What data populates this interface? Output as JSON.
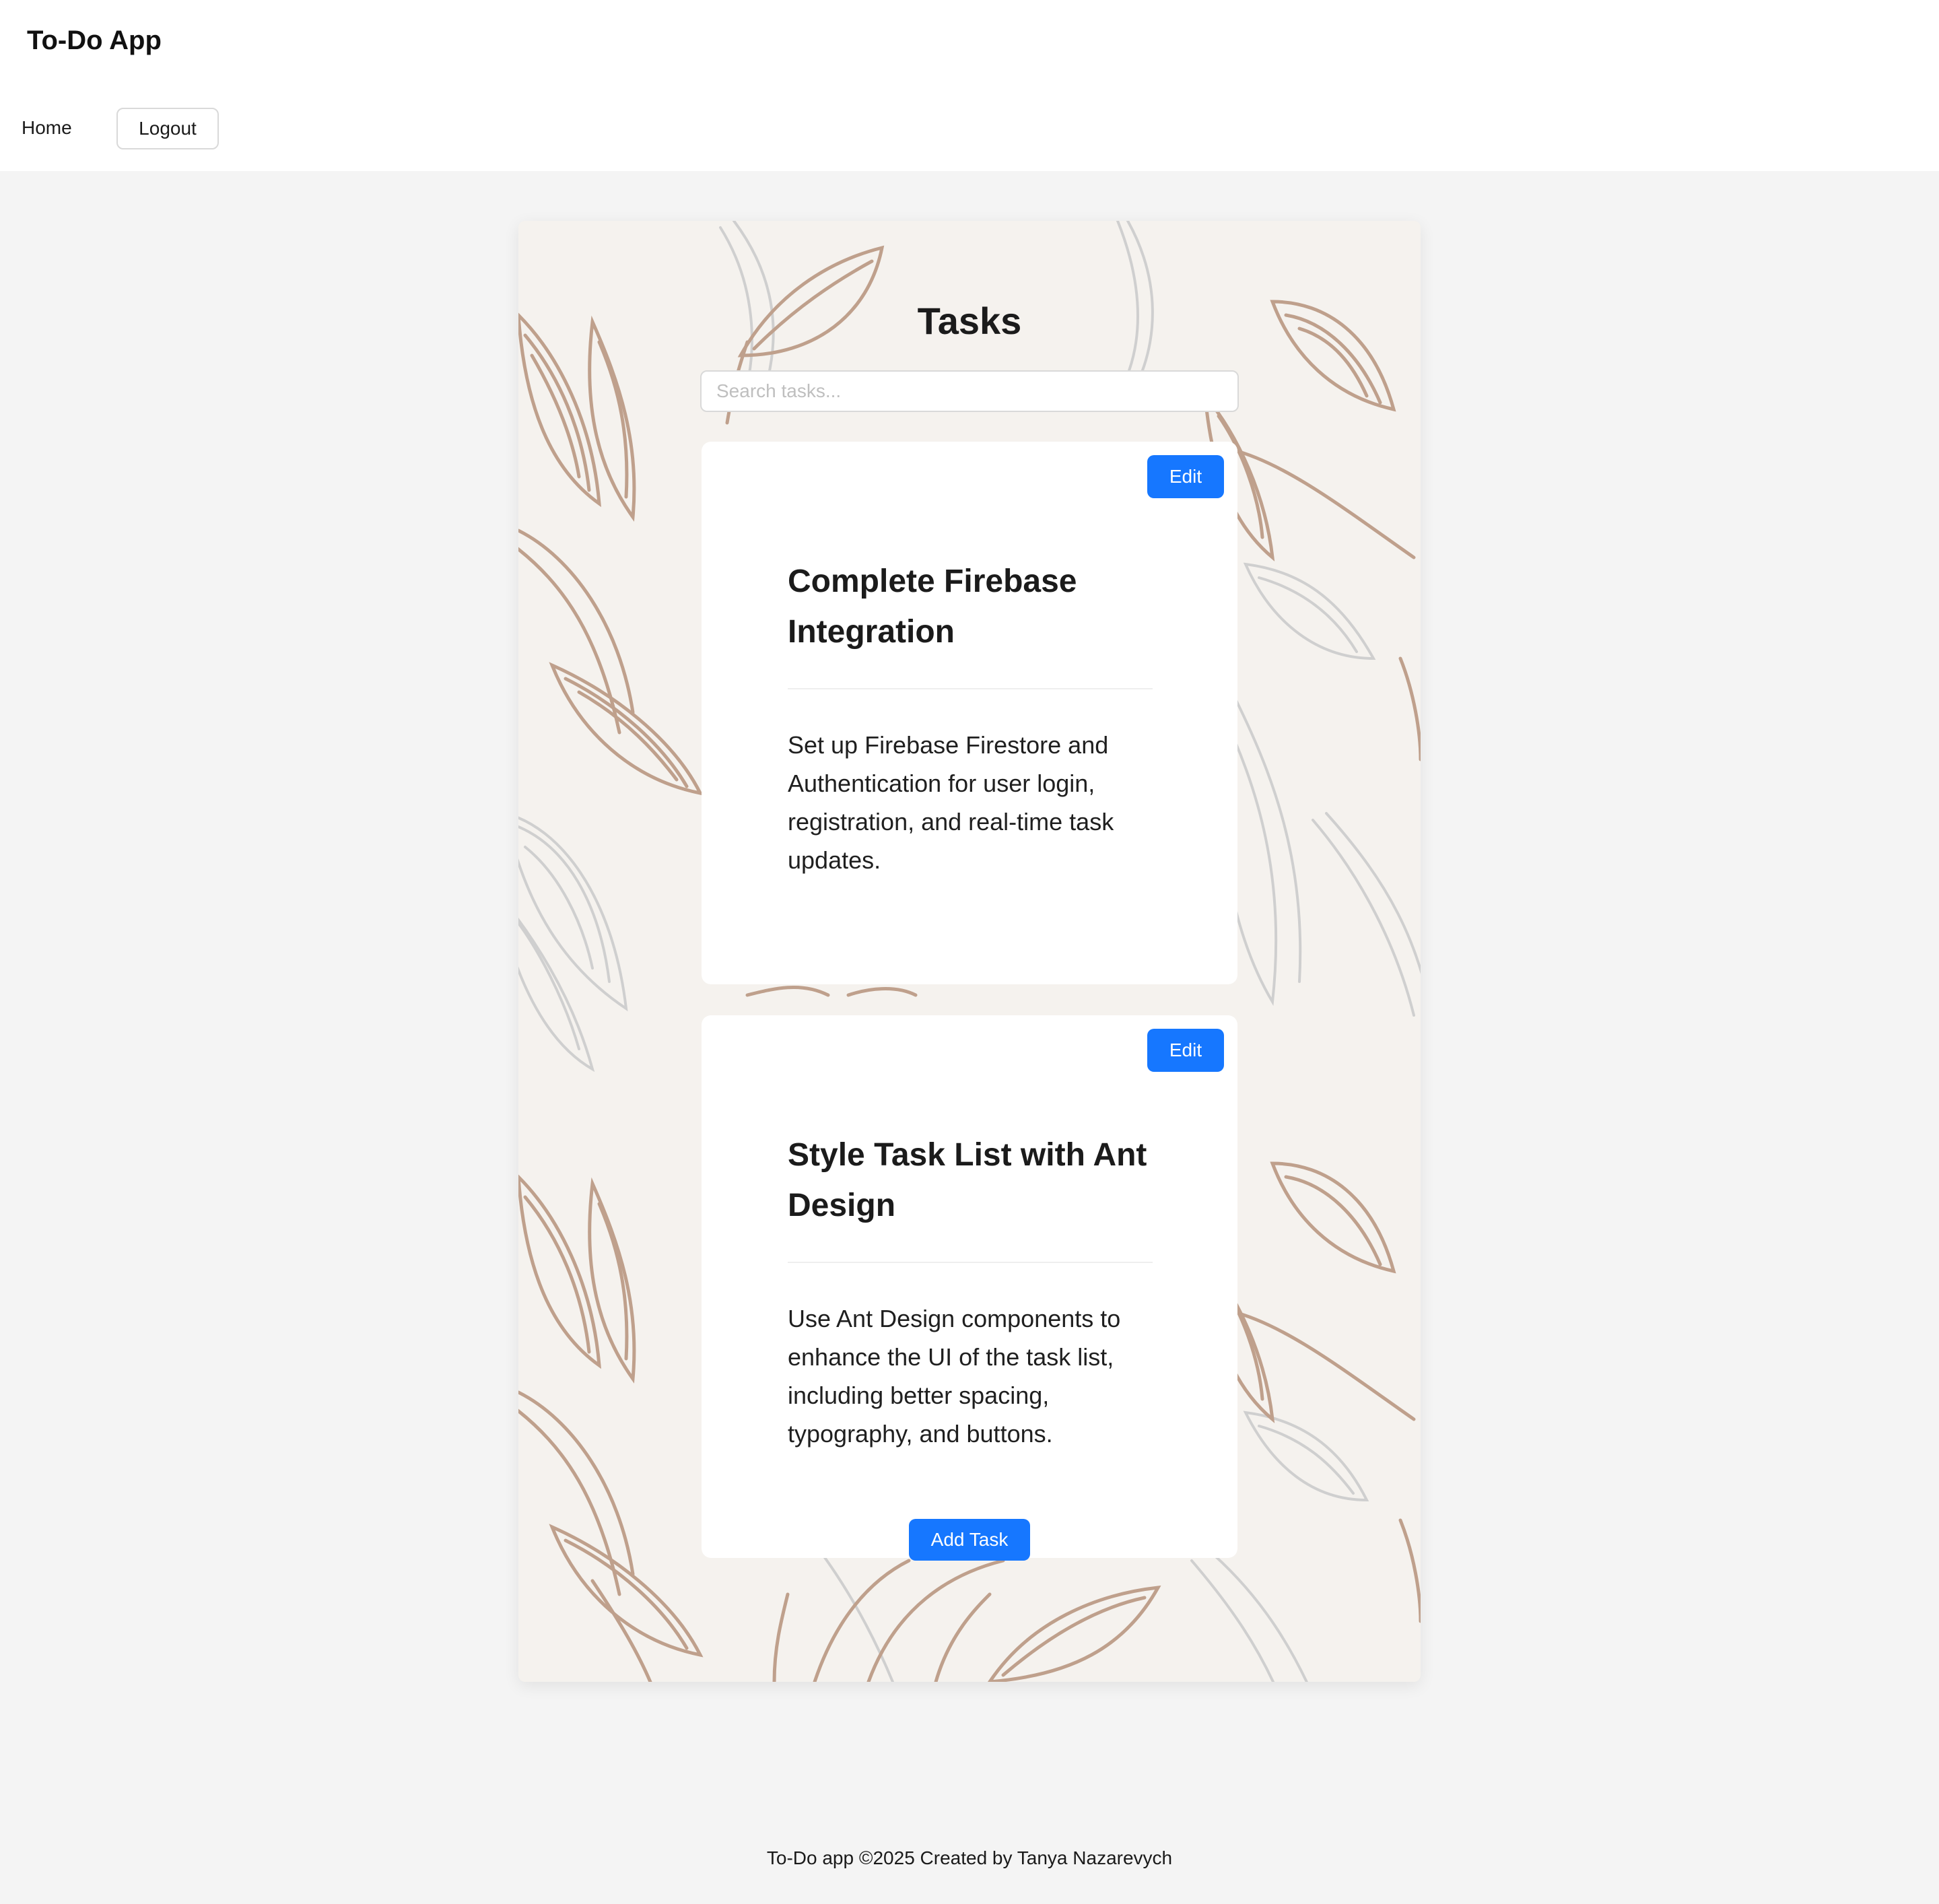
{
  "header": {
    "app_title": "To-Do App",
    "nav": {
      "home": "Home",
      "logout": "Logout"
    }
  },
  "main": {
    "title": "Tasks",
    "search": {
      "placeholder": "Search tasks...",
      "value": ""
    },
    "tasks": [
      {
        "title": "Complete Firebase Integration",
        "description": "Set up Firebase Firestore and Authentication for user login, registration, and real-time task updates.",
        "edit_label": "Edit"
      },
      {
        "title": "Style Task List with Ant Design",
        "description": "Use Ant Design components to enhance the UI of the task list, including better spacing, typography, and buttons.",
        "edit_label": "Edit"
      }
    ],
    "add_task_label": "Add Task"
  },
  "footer": {
    "text": "To-Do app ©2025 Created by Tanya Nazarevych"
  },
  "colors": {
    "primary": "#1677ff",
    "page_bg": "#f4f4f4",
    "panel_bg": "#f5f2ee",
    "leaf_brown": "#bfa08c",
    "leaf_gray": "#cfcfcf"
  }
}
